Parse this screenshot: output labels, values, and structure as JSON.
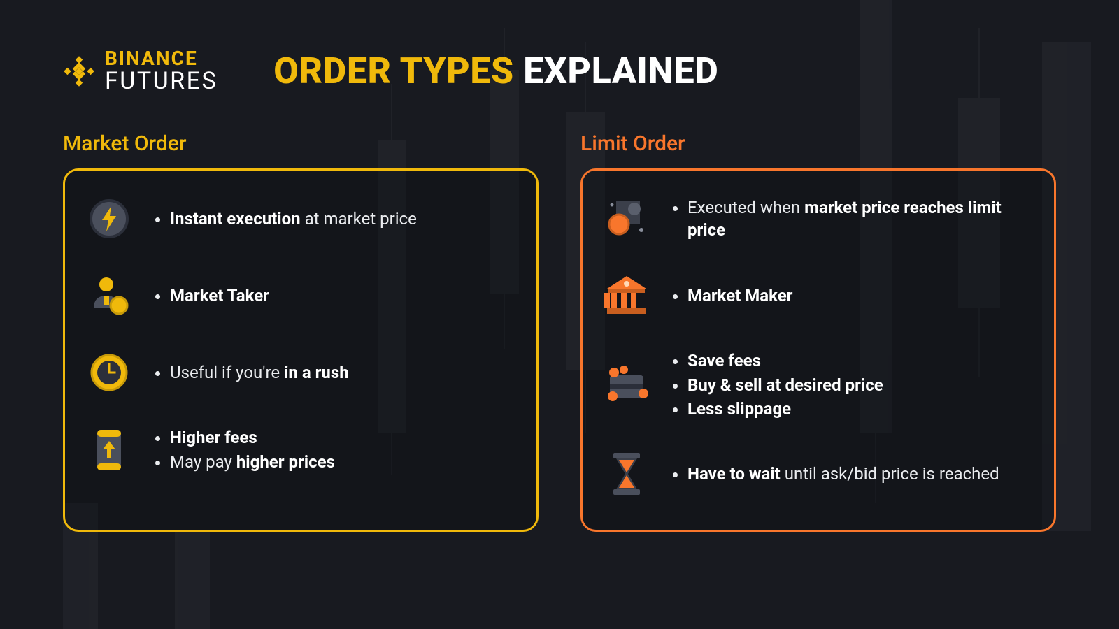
{
  "logo": {
    "line1": "BINANCE",
    "line2": "FUTURES"
  },
  "title": {
    "gold": "ORDER TYPES",
    "white": "EXPLAINED"
  },
  "colors": {
    "gold": "#f0b90b",
    "orange": "#f8762c",
    "bg": "#181a20"
  },
  "cards": {
    "market": {
      "title": "Market Order",
      "rows": [
        {
          "icon": "lightning",
          "html": "<ul><li><b>Instant execution</b> at market price</li></ul>"
        },
        {
          "icon": "person-coin",
          "html": "<ul><li><b>Market Taker</b></li></ul>"
        },
        {
          "icon": "clock",
          "html": "<ul><li>Useful if you're <b>in a rush</b></li></ul>"
        },
        {
          "icon": "phone-up",
          "html": "<ul><li><b>Higher fees</b></li><li>May pay <b>higher prices</b></li></ul>"
        }
      ]
    },
    "limit": {
      "title": "Limit Order",
      "rows": [
        {
          "icon": "target-coin",
          "html": "<ul><li>Executed when <b>market price reaches limit price</b></li></ul>"
        },
        {
          "icon": "bank",
          "html": "<ul><li><b>Market Maker</b></li></ul>"
        },
        {
          "icon": "wallet-coins",
          "html": "<ul><li><b>Save fees</b></li><li><b>Buy &amp; sell at desired price</b></li><li><b>Less slippage</b></li></ul>"
        },
        {
          "icon": "hourglass",
          "html": "<ul><li><b>Have to wait</b> until ask/bid price is reached</li></ul>"
        }
      ]
    }
  }
}
